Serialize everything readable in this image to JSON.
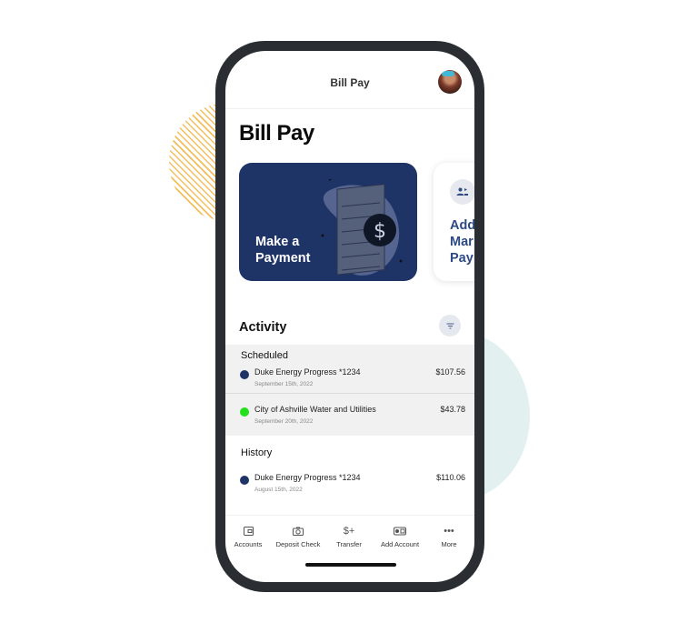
{
  "header": {
    "title": "Bill Pay",
    "avatar_alt": "user-avatar"
  },
  "page": {
    "title": "Bill Pay"
  },
  "cards": [
    {
      "label_line1": "Make a",
      "label_line2": "Payment",
      "icon": "dollar-document-illustration"
    },
    {
      "label_line1": "Add",
      "label_line2": "Manage",
      "label_line3": "Payees",
      "visible_text": [
        "Add",
        "Mar",
        "Pay"
      ],
      "icon": "payees-icon"
    }
  ],
  "activity": {
    "title": "Activity",
    "filter_icon": "filter-icon",
    "scheduled": {
      "label": "Scheduled",
      "items": [
        {
          "payee": "Duke Energy Progress *1234",
          "date": "September 15th, 2022",
          "amount": "$107.56",
          "dot_color": "#1f3466"
        },
        {
          "payee": "City of Ashville Water and Utilities",
          "date": "September 20th, 2022",
          "amount": "$43.78",
          "dot_color": "#22e01c"
        }
      ]
    },
    "history": {
      "label": "History",
      "items": [
        {
          "payee": "Duke Energy Progress *1234",
          "date": "August 15th, 2022",
          "amount": "$110.06",
          "dot_color": "#1f3466"
        }
      ]
    }
  },
  "tabbar": {
    "tabs": [
      {
        "label": "Accounts",
        "icon": "wallet-icon"
      },
      {
        "label": "Deposit Check",
        "icon": "camera-icon"
      },
      {
        "label": "Transfer",
        "icon": "dollar-plus-icon"
      },
      {
        "label": "Add Account",
        "icon": "add-account-icon"
      },
      {
        "label": "More",
        "icon": "more-dots-icon"
      }
    ]
  },
  "colors": {
    "brand_navy": "#1f3466",
    "link_blue": "#2d4a82",
    "status_green": "#22e01c",
    "phone_frame": "#2a2e32"
  }
}
